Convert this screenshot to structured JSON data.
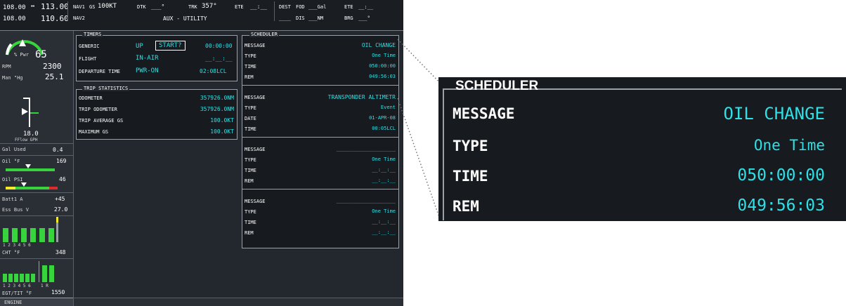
{
  "topbar": {
    "com1_active": "108.00",
    "com1_arrow": "↔",
    "com1_standby": "113.00",
    "com2_active": "108.00",
    "com2_standby": "110.60",
    "nav1_label": "NAV1",
    "nav2_label": "NAV2",
    "gs_label": "GS",
    "gs_value": "100KT",
    "dtk_label": "DTK",
    "dtk_value": "___°",
    "trk_label": "TRK",
    "trk_value": "357°",
    "ete_label": "ETE",
    "ete_value": "__:__",
    "page_name": "AUX - UTILITY",
    "dest_label": "DEST",
    "fod_label": "FOD",
    "fod_value": "___Gal",
    "ete2_label": "ETE",
    "ete2_value": "__:__",
    "dis_value": "____",
    "dis_label": "DIS",
    "dis_unit": "___NM",
    "brg_label": "BRG",
    "brg_value": "___°"
  },
  "engine": {
    "pct_pwr_label": "% Pwr",
    "pct_pwr_value": "65",
    "rpm_label": "RPM",
    "rpm_value": "2300",
    "man_label": "Man \"Hg",
    "man_value": "25.1",
    "fflow_value": "18.0",
    "fflow_label": "FFlow GPH",
    "gal_used_label": "Gal Used",
    "gal_used_value": "0.4",
    "oil_temp_label": "Oil °F",
    "oil_temp_value": "169",
    "oil_psi_label": "Oil PSI",
    "oil_psi_value": "46",
    "batt_label": "Batt1 A",
    "batt_value": "+45",
    "ess_bus_label": "Ess Bus V",
    "ess_bus_value": "27.0",
    "cht_cyl_nums": "1 2 3 4 5 6",
    "cht_label": "CHT °F",
    "cht_value": "348",
    "egt_cyl_nums": "1 2 3 4 5 6",
    "egt_tit_marks": "1 R",
    "egt_label": "EGT/TIT °F",
    "egt_value": "1550",
    "footer": "ENGINE"
  },
  "timers": {
    "title": "TIMERS",
    "generic_label": "GENERIC",
    "generic_dir": "UP",
    "start_button": "START?",
    "generic_time": "00:00:00",
    "flight_label": "FLIGHT",
    "flight_mode": "IN-AIR",
    "flight_time": "__:__:__",
    "departure_label": "DEPARTURE TIME",
    "departure_mode": "PWR-ON",
    "departure_time": "02:08LCL"
  },
  "trip": {
    "title": "TRIP STATISTICS",
    "rows": [
      {
        "label": "ODOMETER",
        "value": "357926.0NM"
      },
      {
        "label": "TRIP ODOMETER",
        "value": "357926.0NM"
      },
      {
        "label": "TRIP AVERAGE GS",
        "value": "100.0KT"
      },
      {
        "label": "MAXIMUM GS",
        "value": "100.0KT"
      }
    ]
  },
  "scheduler": {
    "title": "SCHEDULER",
    "entries": [
      {
        "message_label": "MESSAGE",
        "message": "OIL CHANGE",
        "type_label": "TYPE",
        "type": "One Time",
        "time_label": "TIME",
        "time": "050:00:00",
        "rem_label": "REM",
        "rem": "049:56:03"
      },
      {
        "message_label": "MESSAGE",
        "message": "TRANSPONDER ALTIMETR",
        "type_label": "TYPE",
        "type": "Event",
        "time_label": "DATE",
        "time": "01-APR-08",
        "rem_label": "TIME",
        "rem": "00:05LCL"
      },
      {
        "message_label": "MESSAGE",
        "message": "____________________",
        "type_label": "TYPE",
        "type": "One Time",
        "time_label": "TIME",
        "time": "__:__:__",
        "rem_label": "REM",
        "rem": "__:__:__"
      },
      {
        "message_label": "MESSAGE",
        "message": "____________________",
        "type_label": "TYPE",
        "type": "One Time",
        "time_label": "TIME",
        "time": "__:__:__",
        "rem_label": "REM",
        "rem": "__:__:__"
      }
    ]
  },
  "inset": {
    "title": "SCHEDULER",
    "message_label": "MESSAGE",
    "message": "OIL CHANGE",
    "type_label": "TYPE",
    "type": "One Time",
    "time_label": "TIME",
    "time": "050:00:00",
    "rem_label": "REM",
    "rem": "049:56:03"
  },
  "colors": {
    "screen_bg": "#23282f",
    "panel_bg": "#171a1e",
    "value_cyan": "#2fe0e6",
    "accent_magenta": "#e23fe0",
    "gauge_green": "#37d43d"
  }
}
